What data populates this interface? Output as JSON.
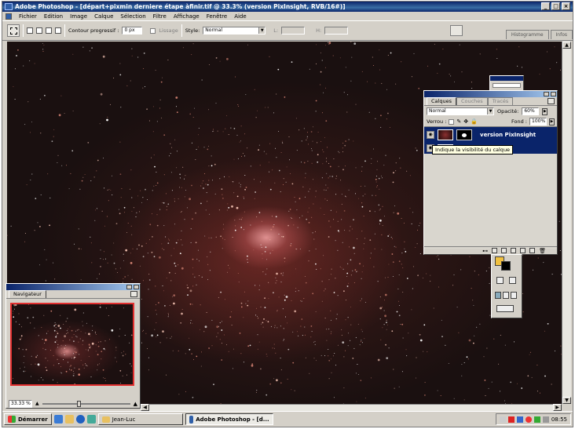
{
  "window": {
    "title": "Adobe Photoshop - [départ+pixmin derniere étape àfinir.tif @ 33.3% (version PixInsight, RVB/16#)]",
    "buttons": [
      "_",
      "□",
      "×"
    ]
  },
  "menu": [
    "Fichier",
    "Edition",
    "Image",
    "Calque",
    "Sélection",
    "Filtre",
    "Affichage",
    "Fenêtre",
    "Aide"
  ],
  "options": {
    "feather_label": "Contour progressif :",
    "feather_value": "0 px",
    "antialias_label": "Lissage",
    "style_label": "Style:",
    "style_value": "Normal",
    "width_label": "L:",
    "height_label": "H:"
  },
  "palette_well": {
    "tabs": [
      "Histogramme",
      "Infos"
    ]
  },
  "layers_panel": {
    "tabs": [
      "Calques",
      "Couches",
      "Tracés"
    ],
    "blend_mode": "Normal",
    "opacity_label": "Opacité:",
    "opacity_value": "60%",
    "lock_label": "Verrou :",
    "fill_label": "Fond :",
    "fill_value": "100%",
    "layer_name": "version PixInsight",
    "tooltip": "Indique la visibilité du calque"
  },
  "navigator": {
    "title": "Navigateur",
    "zoom": "33.33 %"
  },
  "taskbar": {
    "start": "Démarrer",
    "tasks": [
      "Jean-Luc",
      "Adobe Photoshop - [d..."
    ],
    "clock": "08:55"
  },
  "colors": {
    "titlebar": "#0a246a",
    "sky": "#1a1010",
    "nebula": "#c87070",
    "tooltip_bg": "#ffffe1",
    "nav_frame": "#e23030"
  }
}
